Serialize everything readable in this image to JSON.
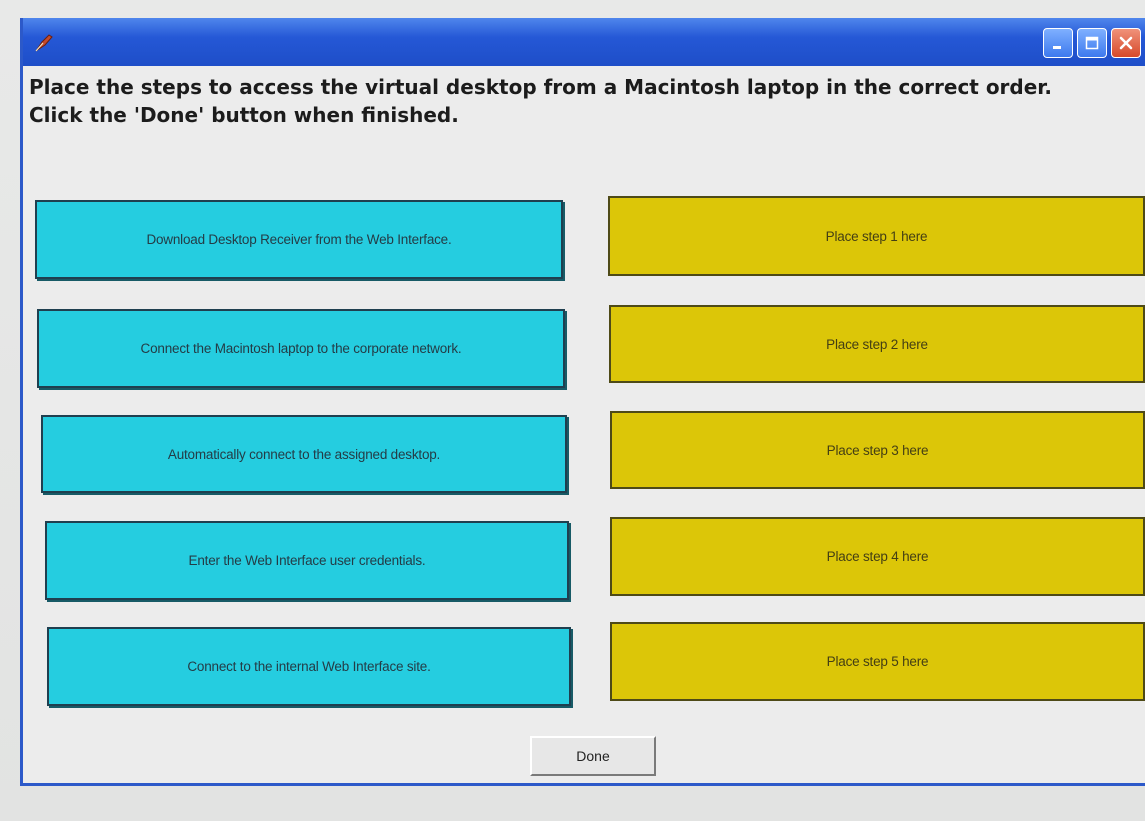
{
  "window": {
    "title_icon": "feather-pen-icon",
    "controls": [
      "minimize-icon",
      "maximize-icon",
      "close-icon"
    ],
    "titlebar_color": "#2558d6"
  },
  "instructions": {
    "line1": "Place the steps to access the virtual desktop from a Macintosh laptop in the correct order.",
    "line2": "Click the 'Done' button when finished."
  },
  "steps": [
    "Download Desktop Receiver from the Web Interface.",
    "Connect the Macintosh laptop to the corporate network.",
    "Automatically connect to the assigned desktop.",
    "Enter the Web Interface user credentials.",
    "Connect to the internal Web Interface site."
  ],
  "targets": [
    "Place step 1 here",
    "Place step 2 here",
    "Place step 3 here",
    "Place step 4 here",
    "Place step 5 here"
  ],
  "done_label": "Done",
  "colors": {
    "source": "#25cde0",
    "target": "#dcc608"
  }
}
